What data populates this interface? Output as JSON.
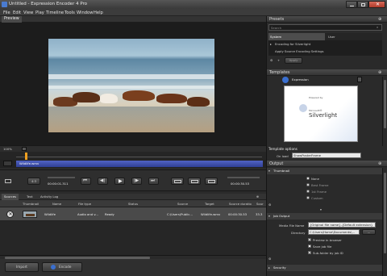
{
  "window": {
    "title": "Untitled - Expression Encoder 4 Pro"
  },
  "menu": [
    "File",
    "Edit",
    "View",
    "Play",
    "Timeline",
    "Tools",
    "Window",
    "Help"
  ],
  "preview": {
    "label": "Preview",
    "zoom": "100%",
    "clip_name": "Wildlife.wmv",
    "ratio": "4:3",
    "timecode": "00:00:01.311",
    "end_timecode": "00:00:30.53"
  },
  "presets": {
    "title": "Presets",
    "search_placeholder": "Search",
    "tabs": [
      "System",
      "User"
    ],
    "items": [
      "Encoding for Silverlight",
      "Apply Source Encoding Settings"
    ],
    "apply_label": "Apply"
  },
  "templates": {
    "title": "Templates",
    "selected": "Expression",
    "thumb_powered": "Powered by",
    "thumb_brand_small": "Microsoft®",
    "thumb_brand": "Silverlight"
  },
  "template_options": {
    "title": "Template options",
    "on_load_label": "On load",
    "on_load_value": "ShowPosterFrame"
  },
  "output": {
    "title": "Output",
    "thumbnail": {
      "title": "Thumbnail",
      "options": [
        "None",
        "Best Frame",
        "1st Frame",
        "Custom"
      ],
      "selected": "None"
    },
    "job_output": {
      "title": "Job Output",
      "media_file_name_label": "Media File Name",
      "media_file_name_value": "{Original file name}.{Default extension}",
      "directory_label": "Directory",
      "directory_value": "C:\\Users\\Home\\Documents\\...",
      "browse_label": "...",
      "checks": [
        {
          "label": "Preview in browser",
          "checked": true
        },
        {
          "label": "Save job file",
          "checked": false
        },
        {
          "label": "Sub-folder by job ID",
          "checked": true
        }
      ]
    },
    "security": {
      "title": "Security"
    }
  },
  "media": {
    "tabs": [
      "Sources",
      "Text",
      "Activity Log"
    ],
    "columns": [
      "Thumbnail",
      "Name",
      "File type",
      "Status",
      "Source",
      "Target",
      "Source duratio",
      "Sour"
    ],
    "rows": [
      {
        "name": "Wildlife",
        "file_type": "Audio and v...",
        "status": "Ready",
        "source": "C:\\Users\\Public...",
        "target": "Wildlife.wmv",
        "duration": "00:00:30.53",
        "extra": "33.3"
      }
    ]
  },
  "bottom": {
    "import_label": "Import",
    "encode_label": "Encode"
  },
  "colors": {
    "accent": "#2f5fbf",
    "timeline_bar": "#3c4fa8",
    "playhead": "#f0a020"
  }
}
